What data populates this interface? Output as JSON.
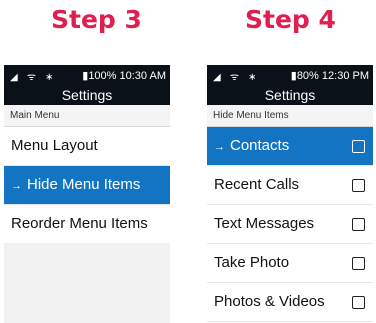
{
  "step3": {
    "heading": "Step 3",
    "status": {
      "icons": "◢ ᯤ ∗",
      "battery": "▮100%",
      "time": "10:30 AM"
    },
    "title": "Settings",
    "section": "Main Menu",
    "items": [
      {
        "label": "Menu Layout"
      },
      {
        "label": "Hide Menu Items",
        "arrow": "→"
      },
      {
        "label": "Reorder Menu Items"
      }
    ]
  },
  "step4": {
    "heading": "Step 4",
    "status": {
      "icons": "◢ ᯤ ∗",
      "battery": "▮80%",
      "time": "12:30 PM"
    },
    "title": "Settings",
    "section": "Hide Menu Items",
    "items": [
      {
        "label": "Contacts",
        "arrow": "→",
        "checked": false
      },
      {
        "label": "Recent Calls",
        "checked": false
      },
      {
        "label": "Text Messages",
        "checked": false
      },
      {
        "label": "Take Photo",
        "checked": false
      },
      {
        "label": "Photos & Videos",
        "checked": false
      }
    ]
  },
  "colors": {
    "heading": "#e01e50",
    "selected": "#1474c4",
    "statusbar": "#0a1118"
  }
}
